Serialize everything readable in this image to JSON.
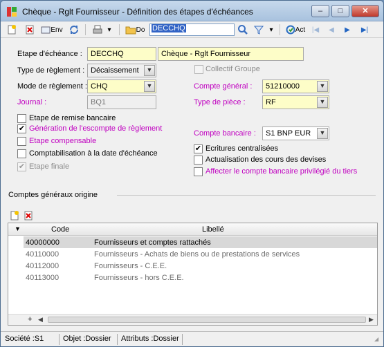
{
  "window": {
    "title": "Chèque - Rglt Fournisseur -  Définition des étapes d'échéances",
    "controls": {
      "minimize": "–",
      "maximize": "□",
      "close": "✕"
    }
  },
  "toolbar": {
    "env_label": "Env",
    "folder_label": "Do",
    "search_value": "DECCHQ",
    "act_label": "Act"
  },
  "form": {
    "etape_label": "Etape d'échéance :",
    "etape_code": "DECCHQ",
    "etape_name": "Chèque - Rglt Fournisseur",
    "type_reglement_label": "Type de règlement :",
    "type_reglement_value": "Décaissement",
    "collectif_label": "Collectif Groupe",
    "mode_reglement_label": "Mode de règlement :",
    "mode_reglement_value": "CHQ",
    "compte_general_label": "Compte général :",
    "compte_general_value": "51210000",
    "journal_label": "Journal :",
    "journal_value": "BQ1",
    "type_piece_label": "Type de pièce :",
    "type_piece_value": "RF",
    "compte_bancaire_label": "Compte bancaire :",
    "compte_bancaire_value": "S1 BNP EUR"
  },
  "checkboxes_left": [
    {
      "label": "Etape de remise bancaire",
      "checked": false,
      "style": "normal"
    },
    {
      "label": "Génération de l'escompte de règlement",
      "checked": true,
      "style": "magenta"
    },
    {
      "label": "Etape compensable",
      "checked": false,
      "style": "magenta"
    },
    {
      "label": "Comptabilisation à la date d'échéance",
      "checked": false,
      "style": "normal"
    },
    {
      "label": "Etape finale",
      "checked": true,
      "style": "disabled"
    }
  ],
  "checkboxes_right": [
    {
      "label": "Ecritures centralisées",
      "checked": true,
      "style": "normal"
    },
    {
      "label": "Actualisation des cours des devises",
      "checked": false,
      "style": "normal"
    },
    {
      "label": "Affecter le compte bancaire privilégié du tiers",
      "checked": false,
      "style": "magenta"
    }
  ],
  "grid": {
    "section_title": "Comptes généraux origine",
    "columns": [
      "Code",
      "Libellé"
    ],
    "rows": [
      {
        "code": "40000000",
        "libelle": "Fournisseurs et comptes rattachés"
      },
      {
        "code": "40110000",
        "libelle": "Fournisseurs - Achats de biens ou de prestations de services"
      },
      {
        "code": "40112000",
        "libelle": "Fournisseurs - C.E.E."
      },
      {
        "code": "40113000",
        "libelle": "Fournisseurs - hors C.E.E."
      }
    ],
    "add_row_symbol": "+"
  },
  "status": {
    "societe": "Société :S1",
    "objet": "Objet :Dossier",
    "attributs": "Attributs :Dossier"
  },
  "colors": {
    "magenta": "#c000c0",
    "yellow_field": "#fdfdc8",
    "selection": "#3163c5"
  }
}
